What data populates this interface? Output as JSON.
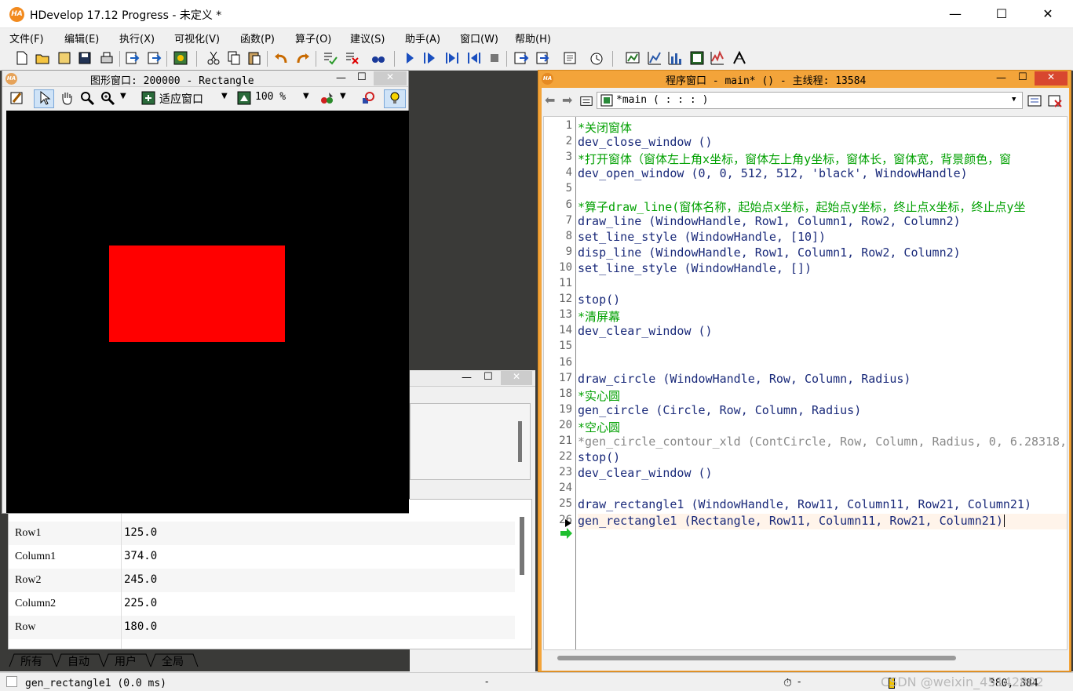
{
  "app": {
    "title": "HDevelop 17.12 Progress - 未定义 *",
    "logo_text": "HA"
  },
  "window_controls": {
    "minimize": "—",
    "maximize": "☐",
    "close": "✕"
  },
  "menu": [
    "文件(F)",
    "编辑(E)",
    "执行(X)",
    "可视化(V)",
    "函数(P)",
    "算子(O)",
    "建议(S)",
    "助手(A)",
    "窗口(W)",
    "帮助(H)"
  ],
  "graphics_window": {
    "title": "图形窗口: 200000 - Rectangle",
    "fit_label": "适应窗口",
    "zoom_label": "100 %",
    "rect_color": "#ff0000"
  },
  "program_window": {
    "title": "程序窗口 - main* () - 主线程: 13584",
    "procedure": "*main ( : : : )"
  },
  "code": [
    {
      "n": "1",
      "text": "*关闭窗体",
      "kind": "comment"
    },
    {
      "n": "2",
      "text": "dev_close_window ()",
      "kind": "code"
    },
    {
      "n": "3",
      "text": "*打开窗体（窗体左上角x坐标，窗体左上角y坐标，窗体长，窗体宽，背景颜色，窗",
      "kind": "comment"
    },
    {
      "n": "4",
      "text": "dev_open_window (0, 0, 512, 512, 'black', WindowHandle)",
      "kind": "code"
    },
    {
      "n": "5",
      "text": "",
      "kind": "code"
    },
    {
      "n": "6",
      "text": "*算子draw_line(窗体名称，起始点x坐标，起始点y坐标，终止点x坐标，终止点y坐",
      "kind": "comment"
    },
    {
      "n": "7",
      "text": "draw_line (WindowHandle, Row1, Column1, Row2, Column2)",
      "kind": "code"
    },
    {
      "n": "8",
      "text": "set_line_style (WindowHandle, [10])",
      "kind": "code"
    },
    {
      "n": "9",
      "text": "disp_line (WindowHandle, Row1, Column1, Row2, Column2)",
      "kind": "code"
    },
    {
      "n": "10",
      "text": "set_line_style (WindowHandle, [])",
      "kind": "code"
    },
    {
      "n": "11",
      "text": "",
      "kind": "code"
    },
    {
      "n": "12",
      "text": "stop()",
      "kind": "code"
    },
    {
      "n": "13",
      "text": "*清屏幕",
      "kind": "comment"
    },
    {
      "n": "14",
      "text": "dev_clear_window ()",
      "kind": "code"
    },
    {
      "n": "15",
      "text": "",
      "kind": "code"
    },
    {
      "n": "16",
      "text": "",
      "kind": "code"
    },
    {
      "n": "17",
      "text": "draw_circle (WindowHandle, Row, Column, Radius)",
      "kind": "code"
    },
    {
      "n": "18",
      "text": "*实心圆",
      "kind": "comment"
    },
    {
      "n": "19",
      "text": "gen_circle (Circle, Row, Column, Radius)",
      "kind": "code"
    },
    {
      "n": "20",
      "text": "*空心圆",
      "kind": "comment"
    },
    {
      "n": "21",
      "text": "*gen_circle_contour_xld (ContCircle, Row, Column, Radius, 0, 6.28318,",
      "kind": "disabled"
    },
    {
      "n": "22",
      "text": "stop()",
      "kind": "code"
    },
    {
      "n": "23",
      "text": "dev_clear_window ()",
      "kind": "code"
    },
    {
      "n": "24",
      "text": "",
      "kind": "code"
    },
    {
      "n": "25",
      "text": "draw_rectangle1 (WindowHandle, Row11, Column11, Row21, Column21)",
      "kind": "code"
    },
    {
      "n": "26",
      "text": "gen_rectangle1 (Rectangle, Row11, Column11, Row21, Column21)",
      "kind": "code"
    }
  ],
  "variables": [
    {
      "name": "Row1",
      "value": "125.0"
    },
    {
      "name": "Column1",
      "value": "374.0"
    },
    {
      "name": "Row2",
      "value": "245.0"
    },
    {
      "name": "Column2",
      "value": "225.0"
    },
    {
      "name": "Row",
      "value": "180.0"
    }
  ],
  "variable_tabs": [
    "所有",
    "自动",
    "用户",
    "全局"
  ],
  "status": {
    "message": "gen_rectangle1 (0.0 ms)",
    "coords": "380, 384",
    "watermark": "CSDN @weixin_45142802"
  }
}
